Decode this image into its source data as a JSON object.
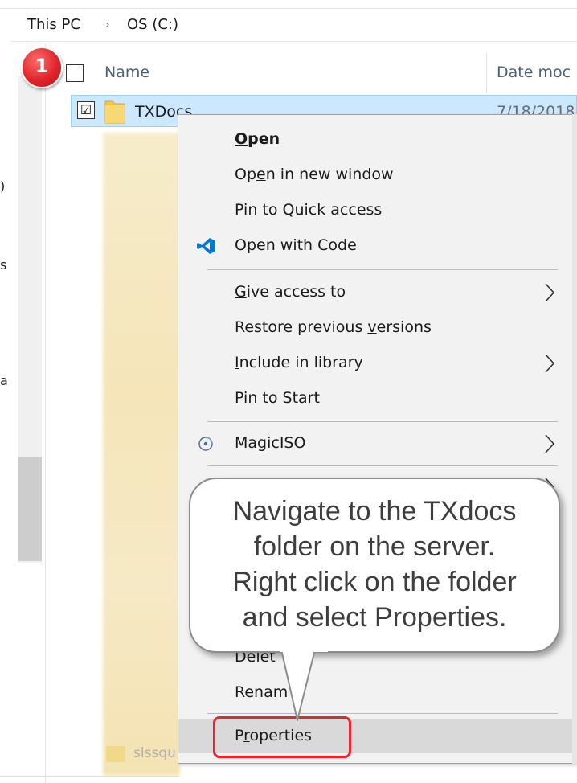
{
  "breadcrumb": {
    "items": [
      "This PC",
      "OS (C:)"
    ],
    "separator": "›"
  },
  "nav": {
    "partial_labels": [
      "",
      ")",
      "s",
      "a"
    ]
  },
  "columns": {
    "name": "Name",
    "date": "Date moc"
  },
  "selected_row": {
    "name": "TXDocs",
    "date": "7/18/2018",
    "check": "☑"
  },
  "background_rows": {
    "last_partial_name": "slssqu"
  },
  "context_menu": {
    "items": [
      {
        "label": "Open",
        "bold": true,
        "access_key": "O",
        "submenu": false
      },
      {
        "label": "Open in new window",
        "access_key": "e",
        "submenu": false
      },
      {
        "label": "Pin to Quick access",
        "submenu": false
      },
      {
        "label": "Open with Code",
        "icon": "vscode-icon",
        "submenu": false
      },
      {
        "label": "Give access to",
        "access_key": "G",
        "submenu": true
      },
      {
        "label": "Restore previous versions",
        "access_key": "v",
        "submenu": false
      },
      {
        "label": "Include in library",
        "access_key": "I",
        "submenu": true
      },
      {
        "label": "Pin to Start",
        "access_key": "P",
        "submenu": false
      },
      {
        "label": "MagicISO",
        "icon": "magiciso-icon",
        "submenu": true
      },
      {
        "label": "Delete",
        "access_key": "D",
        "submenu": false,
        "partial_visible": "Delet"
      },
      {
        "label": "Rename",
        "access_key": "m",
        "submenu": false,
        "partial_visible": "Renam"
      },
      {
        "label": "Properties",
        "access_key": "r",
        "submenu": false,
        "hovered": true
      }
    ]
  },
  "annotation": {
    "step_number": "1",
    "callout_lines": [
      "Navigate to the TXdocs",
      "folder on the server.",
      "Right click on the folder",
      "and select Properties."
    ],
    "highlight_color": "#e8242c"
  },
  "colors": {
    "selection_bg": "#cce8ff",
    "menu_bg": "#f2f2f2",
    "folder_yellow": "#f1c84b",
    "vscode_blue": "#0078d4"
  }
}
